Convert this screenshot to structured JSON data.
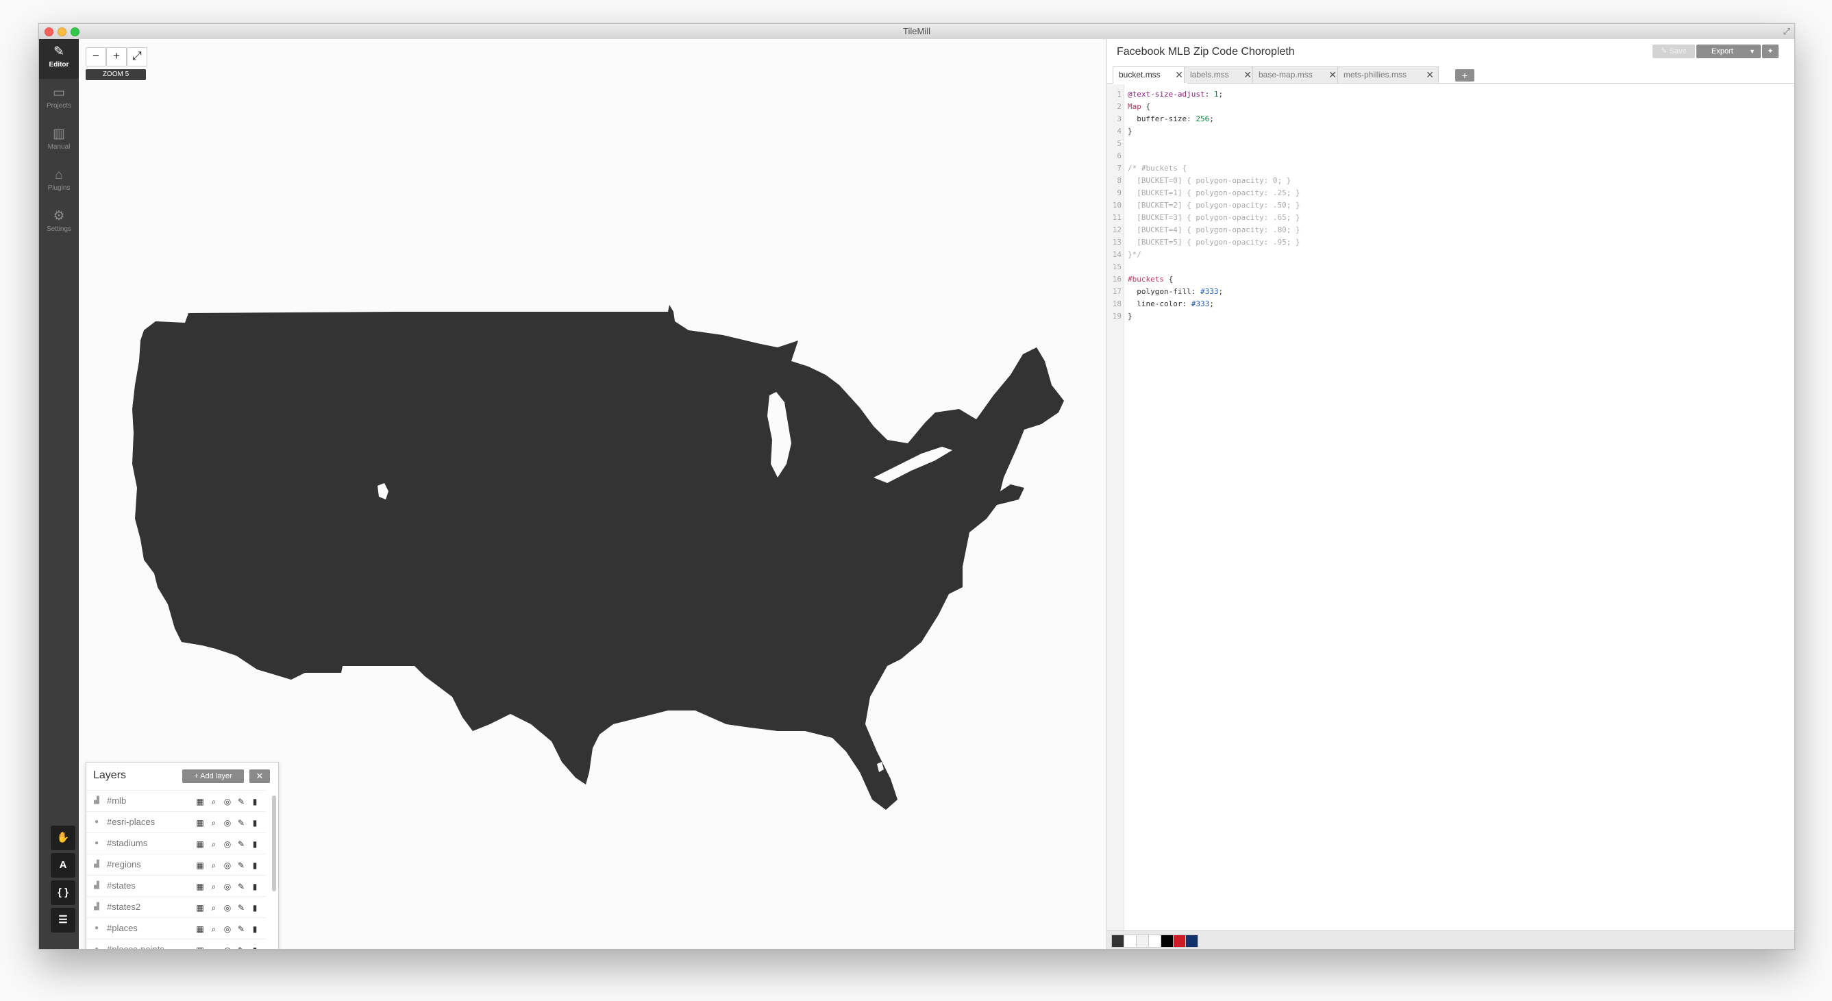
{
  "window": {
    "title": "TileMill"
  },
  "sidebar": {
    "items": [
      {
        "label": "Editor",
        "icon": "pencil-icon",
        "active": true
      },
      {
        "label": "Projects",
        "icon": "folder-icon"
      },
      {
        "label": "Manual",
        "icon": "book-icon"
      },
      {
        "label": "Plugins",
        "icon": "plugin-icon"
      },
      {
        "label": "Settings",
        "icon": "gear-icon"
      }
    ],
    "tools": [
      {
        "label": "✋",
        "icon": "hand-icon"
      },
      {
        "label": "A",
        "icon": "font-icon"
      },
      {
        "label": "{ }",
        "icon": "braces-icon"
      },
      {
        "label": "☰",
        "icon": "layers-icon"
      }
    ]
  },
  "map": {
    "zoom_out": "−",
    "zoom_in": "+",
    "fullscreen": "⤢",
    "zoom_label": "ZOOM 5",
    "fill_color": "#333333"
  },
  "layers": {
    "title": "Layers",
    "add_label": "Add layer",
    "items": [
      {
        "name": "#mlb",
        "type": "polygon"
      },
      {
        "name": "#esri-places",
        "type": "point"
      },
      {
        "name": "#stadiums",
        "type": "point"
      },
      {
        "name": "#regions",
        "type": "polygon"
      },
      {
        "name": "#states",
        "type": "polygon"
      },
      {
        "name": "#states2",
        "type": "polygon"
      },
      {
        "name": "#places",
        "type": "point"
      },
      {
        "name": "#places-points",
        "type": "point"
      }
    ],
    "action_icons": [
      "table-icon",
      "search-icon",
      "eye-icon",
      "pencil-icon",
      "trash-icon"
    ]
  },
  "editor": {
    "project_title": "Facebook MLB Zip Code Choropleth",
    "save_label": "Save",
    "export_label": "Export",
    "tabs": [
      {
        "label": "bucket.mss",
        "active": true
      },
      {
        "label": "labels.mss"
      },
      {
        "label": "base-map.mss"
      },
      {
        "label": "mets-phillies.mss"
      }
    ],
    "line_numbers": [
      "1",
      "2",
      "3",
      "4",
      "5",
      "6",
      "7",
      "8",
      "9",
      "10",
      "11",
      "12",
      "13",
      "14",
      "15",
      "16",
      "17",
      "18",
      "19"
    ],
    "code_lines": [
      "@text-size-adjust: 1;",
      "Map {",
      "  buffer-size: 256;",
      "}",
      "",
      "",
      "/* #buckets {",
      "  [BUCKET=0] { polygon-opacity: 0; }",
      "  [BUCKET=1] { polygon-opacity: .25; }",
      "  [BUCKET=2] { polygon-opacity: .50; }",
      "  [BUCKET=3] { polygon-opacity: .65; }",
      "  [BUCKET=4] { polygon-opacity: .80; }",
      "  [BUCKET=5] { polygon-opacity: .95; }",
      "}*/",
      "",
      "#buckets {",
      "  polygon-fill: #333;",
      "  line-color: #333;",
      "}"
    ]
  },
  "palette": [
    "#333333",
    "#ffffff",
    "#f2f2f2",
    "#ffffff",
    "#000000",
    "#cc1c25",
    "#12326b"
  ]
}
